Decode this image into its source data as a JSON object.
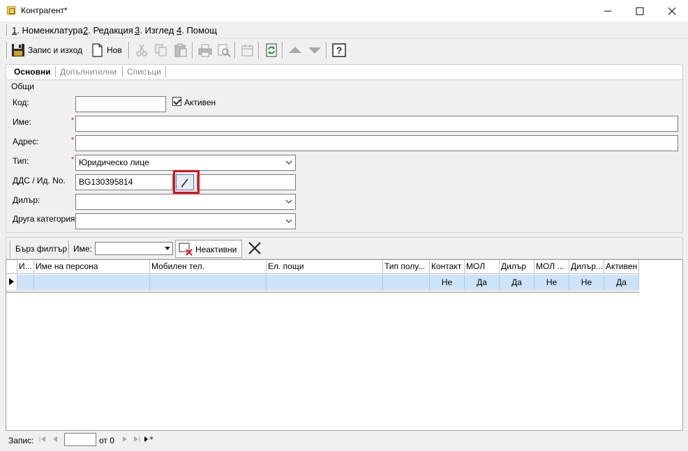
{
  "window": {
    "title": "Контрагент*",
    "minimize": "—",
    "maximize": "☐",
    "close": "✕"
  },
  "menu": [
    {
      "key": "1",
      "label": ". Номенклатура"
    },
    {
      "key": "2",
      "label": ". Редакция"
    },
    {
      "key": "3",
      "label": ". Изглед"
    },
    {
      "key": "4",
      "label": ". Помощ"
    }
  ],
  "toolbar": {
    "save_exit_label": "Запис и изход",
    "new_label": "Нов"
  },
  "tabs": [
    "Основни",
    "Допълнителни",
    "Списъци"
  ],
  "group": {
    "legend": "Общи",
    "code_label": "Код:",
    "code_value": "",
    "active_label": "Активен",
    "name_label": "Име:",
    "name_value": "",
    "address_label": "Адрес:",
    "address_value": "",
    "type_label": "Тип:",
    "type_value": "Юридическо лице",
    "vat_label": "ДДС / Ид. No.",
    "vat_value": "BG130395814",
    "vat_second_value": "",
    "dealer_label": "Дилър:",
    "dealer_value": "",
    "category_label": "Друга категория",
    "category_value": "",
    "required_mark": "*"
  },
  "quick_filter": {
    "label": "Бърз филтър",
    "name_label": "Име:",
    "name_value": "",
    "inactive_label": "Неактивни"
  },
  "grid": {
    "columns": [
      "И...",
      "Име на персона",
      "Мобилен тел.",
      "Ел. пощи",
      "Тип полу...",
      "Контакт",
      "МОЛ",
      "Дилър",
      "МОЛ ...",
      "Дилър...",
      "Активен"
    ],
    "rows": [
      [
        "",
        "",
        "",
        "",
        "",
        "Не",
        "Да",
        "Да",
        "Не",
        "Не",
        "Да"
      ]
    ]
  },
  "status": {
    "record_label": "Запис:",
    "record_value": "",
    "of_label": "от 0"
  },
  "colors": {
    "selected_row": "#cde3f7",
    "required": "#e02020",
    "highlight": "#e0101a"
  }
}
